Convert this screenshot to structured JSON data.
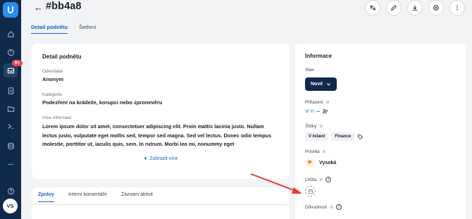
{
  "header": {
    "back_glyph": "←",
    "title": "#bb4a8",
    "actions": [
      "translate-icon",
      "edit-icon",
      "download-icon",
      "print-icon",
      "more-icon"
    ]
  },
  "nav": {
    "badge": "9+",
    "avatar": "VS"
  },
  "tabs": [
    {
      "label": "Detail podnětu",
      "active": true
    },
    {
      "label": "Šetření",
      "active": false
    }
  ],
  "detail": {
    "heading": "Detail podnětu",
    "sender_label": "Odesílatel",
    "sender_value": "Anonym",
    "category_label": "Kategorie",
    "category_value": "Podezření na krádeže, korupci nebo zpronevěru",
    "more_label": "Více informací",
    "more_value": "Lorem ipsum dolor sit amet, consectetuer adipiscing elit. Proin mattis lacinia justo. Nullam lectus justo, vulputate eget mollis sed, tempor sed magna. Sed vel lectus. Donec odio tempus molestie, porttitor ut, iaculis quis, sem. In rutrum. Morbi leo mi, nonummy eget",
    "show_more": "Zobrazit více"
  },
  "bottom_tabs": [
    {
      "label": "Zprávy",
      "active": true
    },
    {
      "label": "Interní komentáře",
      "active": false
    },
    {
      "label": "Záznam aktivit",
      "active": false
    }
  ],
  "info": {
    "heading": "Informace",
    "status_label": "Stav",
    "status_value": "Nové",
    "assigned_label": "Přiřazeni",
    "assigned_avatars": "VI YI",
    "assigned_more": "•••",
    "tags_label": "Štítky",
    "tags": [
      "V řešení",
      "Finance"
    ],
    "priority_label": "Priorita",
    "priority_value": "Vysoká",
    "deadline_label": "Lhůta",
    "reason_label": "Důvodnost"
  },
  "colors": {
    "rail": "#0f2a4a",
    "accent": "#1565c0",
    "badge": "#e5484d",
    "arrow": "#e53935",
    "priority_flag": "#f08a24"
  }
}
